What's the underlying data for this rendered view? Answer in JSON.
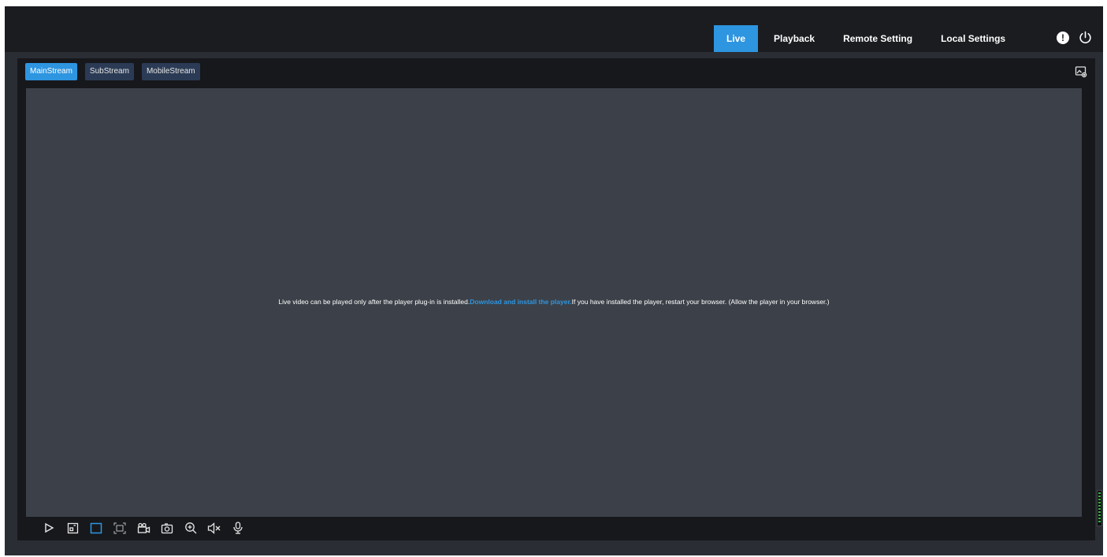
{
  "header": {
    "tabs": [
      {
        "label": "Live",
        "active": true
      },
      {
        "label": "Playback",
        "active": false
      },
      {
        "label": "Remote Setting",
        "active": false
      },
      {
        "label": "Local Settings",
        "active": false
      }
    ],
    "alert_icon": "alert-icon",
    "power_icon": "power-icon"
  },
  "streams": {
    "tabs": [
      {
        "label": "MainStream",
        "active": true
      },
      {
        "label": "SubStream",
        "active": false
      },
      {
        "label": "MobileStream",
        "active": false
      }
    ],
    "corner_icon": "image-settings-icon"
  },
  "video": {
    "message_before": "Live video can be played only after the player plug-in is installed.",
    "link_text": "Download and install the player.",
    "message_after": "If you have installed the player, restart your browser. (Allow the player in your browser.)"
  },
  "toolbar": {
    "icons": [
      "play-icon",
      "single-view-icon",
      "window-layout-icon",
      "fullscreen-icon",
      "record-icon",
      "snapshot-icon",
      "zoom-in-icon",
      "mute-icon",
      "microphone-icon"
    ]
  },
  "colors": {
    "accent": "#2e95e0",
    "header_bg": "#1b1c20",
    "panel_bg": "#17181c",
    "video_bg": "#3c4149",
    "stream_tab_bg": "#2b3b55"
  }
}
